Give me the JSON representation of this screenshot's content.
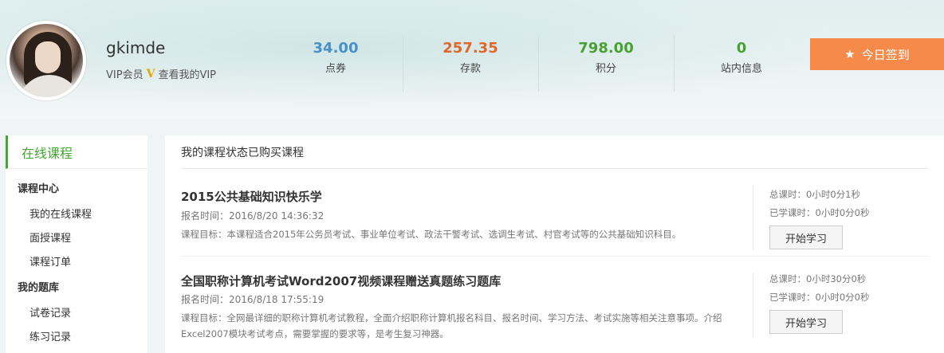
{
  "user": {
    "name": "gkimde",
    "vip_label": "VIP会员",
    "vip_badge": "V",
    "vip_link": "查看我的VIP"
  },
  "stats": [
    {
      "value": "34.00",
      "label": "点券",
      "color": "#4a90c8"
    },
    {
      "value": "257.35",
      "label": "存款",
      "color": "#e0662a"
    },
    {
      "value": "798.00",
      "label": "积分",
      "color": "#4aa033"
    },
    {
      "value": "0",
      "label": "站内信息",
      "color": "#4aa033"
    }
  ],
  "signin": {
    "label": "今日签到",
    "icon": "star-icon"
  },
  "sidebar": {
    "title": "在线课程",
    "groups": [
      {
        "label": "课程中心",
        "items": [
          "我的在线课程",
          "面授课程",
          "课程订单"
        ]
      },
      {
        "label": "我的题库",
        "items": [
          "试卷记录",
          "练习记录"
        ]
      }
    ]
  },
  "main": {
    "header": "我的课程状态已购买课程",
    "courses": [
      {
        "name": "2015公共基础知识快乐学",
        "time": "报名时间：2016/8/20 14:36:32",
        "goal": "课程目标：本课程适合2015年公务员考试、事业单位考试、政法干警考试、选调生考试、村官考试等的公共基础知识科目。",
        "total": "总课时：0小时0分1秒",
        "learned": "已学课时：0小时0分0秒",
        "button": "开始学习"
      },
      {
        "name": "全国职称计算机考试Word2007视频课程赠送真题练习题库",
        "time": "报名时间：2016/8/18 17:55:19",
        "goal": "课程目标：全网最详细的职称计算机考试教程，全面介绍职称计算机报名科目、报名时间、学习方法、考试实施等相关注意事项。介绍Excel2007模块考试考点，需要掌握的要求等，是考生复习神器。",
        "total": "总课时：0小时30分0秒",
        "learned": "已学课时：0小时0分0秒",
        "button": "开始学习"
      }
    ]
  }
}
